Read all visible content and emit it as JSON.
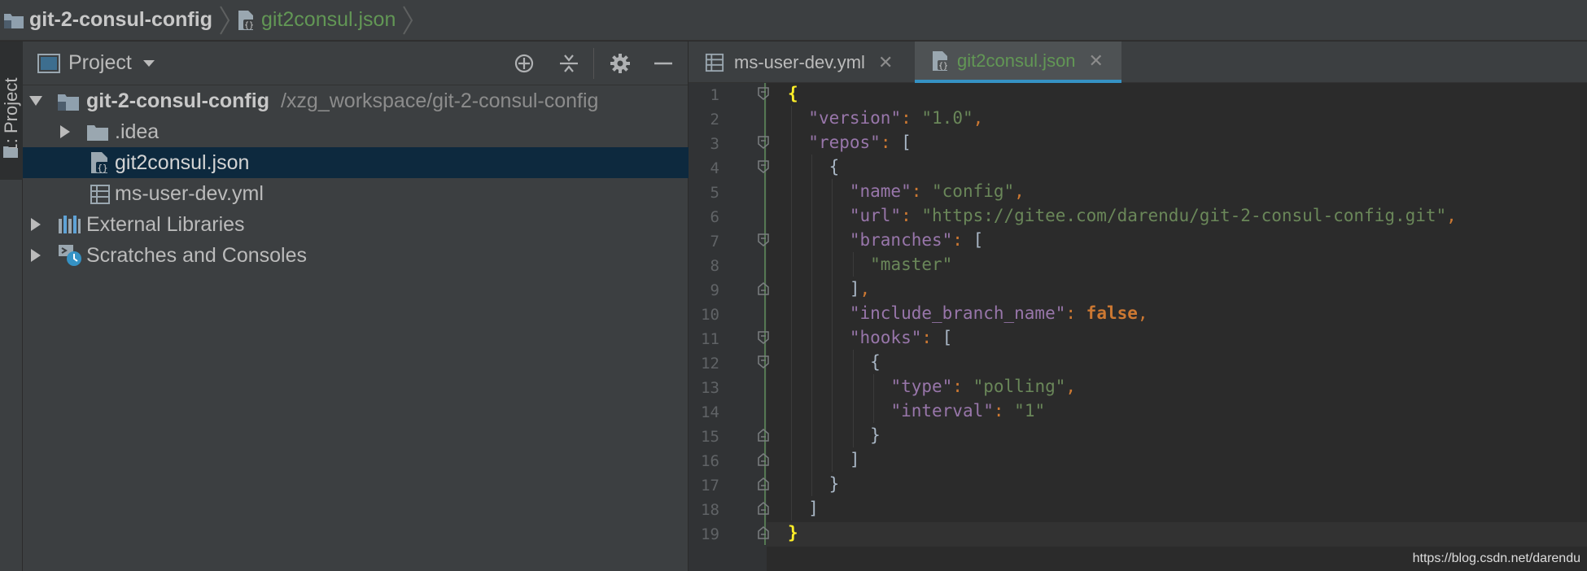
{
  "breadcrumb": {
    "project": "git-2-consul-config",
    "file": "git2consul.json"
  },
  "stripe": {
    "label": "1: Project"
  },
  "project_panel": {
    "title": "Project",
    "tree": [
      {
        "name": "git-2-consul-config",
        "path": "/xzg_workspace/git-2-consul-config",
        "expanded": true,
        "icon": "folder-module-icon"
      },
      {
        "name": ".idea",
        "expanded": false,
        "icon": "folder-icon"
      },
      {
        "name": "git2consul.json",
        "selected": true,
        "icon": "json-file-icon"
      },
      {
        "name": "ms-user-dev.yml",
        "icon": "yaml-file-icon"
      },
      {
        "name": "External Libraries",
        "expanded": false,
        "icon": "libraries-icon"
      },
      {
        "name": "Scratches and Consoles",
        "expanded": false,
        "icon": "scratches-icon"
      }
    ]
  },
  "tabs": [
    {
      "label": "ms-user-dev.yml",
      "active": false
    },
    {
      "label": "git2consul.json",
      "active": true
    }
  ],
  "editor": {
    "line_numbers": [
      "1",
      "2",
      "3",
      "4",
      "5",
      "6",
      "7",
      "8",
      "9",
      "10",
      "11",
      "12",
      "13",
      "14",
      "15",
      "16",
      "17",
      "18",
      "19"
    ],
    "lines": [
      [
        {
          "t": "{",
          "c": "brace-hl"
        }
      ],
      [
        {
          "t": "  "
        },
        {
          "t": "\"version\"",
          "c": "k"
        },
        {
          "t": ": ",
          "c": "c"
        },
        {
          "t": "\"1.0\"",
          "c": "s"
        },
        {
          "t": ",",
          "c": "c"
        }
      ],
      [
        {
          "t": "  "
        },
        {
          "t": "\"repos\"",
          "c": "k"
        },
        {
          "t": ": ",
          "c": "c"
        },
        {
          "t": "[",
          "c": "p"
        }
      ],
      [
        {
          "t": "    "
        },
        {
          "t": "{",
          "c": "p"
        }
      ],
      [
        {
          "t": "      "
        },
        {
          "t": "\"name\"",
          "c": "k"
        },
        {
          "t": ": ",
          "c": "c"
        },
        {
          "t": "\"config\"",
          "c": "s"
        },
        {
          "t": ",",
          "c": "c"
        }
      ],
      [
        {
          "t": "      "
        },
        {
          "t": "\"url\"",
          "c": "k"
        },
        {
          "t": ": ",
          "c": "c"
        },
        {
          "t": "\"https://gitee.com/darendu/git-2-consul-config.git\"",
          "c": "s"
        },
        {
          "t": ",",
          "c": "c"
        }
      ],
      [
        {
          "t": "      "
        },
        {
          "t": "\"branches\"",
          "c": "k"
        },
        {
          "t": ": ",
          "c": "c"
        },
        {
          "t": "[",
          "c": "p"
        }
      ],
      [
        {
          "t": "        "
        },
        {
          "t": "\"master\"",
          "c": "s"
        }
      ],
      [
        {
          "t": "      "
        },
        {
          "t": "]",
          "c": "p"
        },
        {
          "t": ",",
          "c": "c"
        }
      ],
      [
        {
          "t": "      "
        },
        {
          "t": "\"include_branch_name\"",
          "c": "k"
        },
        {
          "t": ": ",
          "c": "c"
        },
        {
          "t": "false",
          "c": "b"
        },
        {
          "t": ",",
          "c": "c"
        }
      ],
      [
        {
          "t": "      "
        },
        {
          "t": "\"hooks\"",
          "c": "k"
        },
        {
          "t": ": ",
          "c": "c"
        },
        {
          "t": "[",
          "c": "p"
        }
      ],
      [
        {
          "t": "        "
        },
        {
          "t": "{",
          "c": "p"
        }
      ],
      [
        {
          "t": "          "
        },
        {
          "t": "\"type\"",
          "c": "k"
        },
        {
          "t": ": ",
          "c": "c"
        },
        {
          "t": "\"polling\"",
          "c": "s"
        },
        {
          "t": ",",
          "c": "c"
        }
      ],
      [
        {
          "t": "          "
        },
        {
          "t": "\"interval\"",
          "c": "k"
        },
        {
          "t": ": ",
          "c": "c"
        },
        {
          "t": "\"1\"",
          "c": "s"
        }
      ],
      [
        {
          "t": "        "
        },
        {
          "t": "}",
          "c": "p"
        }
      ],
      [
        {
          "t": "      "
        },
        {
          "t": "]",
          "c": "p"
        }
      ],
      [
        {
          "t": "    "
        },
        {
          "t": "}",
          "c": "p"
        }
      ],
      [
        {
          "t": "  "
        },
        {
          "t": "]",
          "c": "p"
        }
      ],
      [
        {
          "t": "}",
          "c": "brace-hl"
        }
      ]
    ],
    "fold_open_lines": [
      1,
      3,
      4,
      7,
      11,
      12
    ],
    "fold_close_lines": [
      9,
      15,
      16,
      17,
      18,
      19
    ]
  },
  "watermark": "https://blog.csdn.net/darendu",
  "colors": {
    "accent": "#3592c4",
    "keyword": "#9876aa",
    "string": "#6a8759",
    "punct": "#cc7832"
  }
}
